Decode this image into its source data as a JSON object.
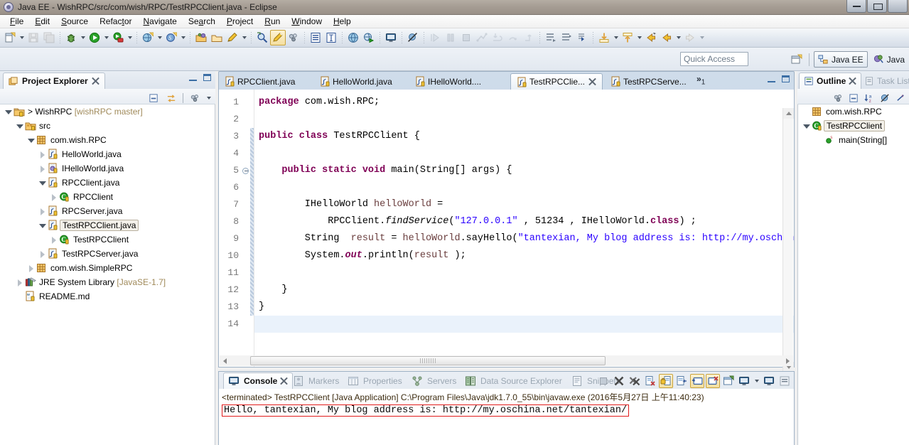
{
  "window": {
    "title": "Java EE - WishRPC/src/com/wish/RPC/TestRPCClient.java - Eclipse",
    "app_icon": "eclipse-icon",
    "controls": {
      "minimize": "minimize-icon",
      "maximize": "maximize-icon",
      "close": "close-icon"
    }
  },
  "menubar": {
    "items": [
      {
        "label": "File",
        "mnemonic": "F"
      },
      {
        "label": "Edit",
        "mnemonic": "E"
      },
      {
        "label": "Source",
        "mnemonic": "S"
      },
      {
        "label": "Refactor",
        "mnemonic": "t"
      },
      {
        "label": "Navigate",
        "mnemonic": "N"
      },
      {
        "label": "Search",
        "mnemonic": "a"
      },
      {
        "label": "Project",
        "mnemonic": "P"
      },
      {
        "label": "Run",
        "mnemonic": "R"
      },
      {
        "label": "Window",
        "mnemonic": "W"
      },
      {
        "label": "Help",
        "mnemonic": "H"
      }
    ]
  },
  "toolbar": {
    "groups": [
      {
        "items": [
          {
            "name": "new-wizard-icon",
            "has_dropdown": true,
            "enabled": true
          },
          {
            "name": "save-icon",
            "has_dropdown": false,
            "enabled": false
          },
          {
            "name": "save-all-icon",
            "has_dropdown": false,
            "enabled": false
          }
        ]
      },
      {
        "items": [
          {
            "name": "debug-icon",
            "has_dropdown": true,
            "enabled": true
          },
          {
            "name": "run-icon",
            "has_dropdown": true,
            "enabled": true
          },
          {
            "name": "external-tools-icon",
            "has_dropdown": true,
            "enabled": true
          }
        ]
      },
      {
        "items": [
          {
            "name": "new-server-icon",
            "has_dropdown": true,
            "enabled": true
          },
          {
            "name": "new-ejb-icon",
            "has_dropdown": true,
            "enabled": true
          }
        ]
      },
      {
        "items": [
          {
            "name": "open-type-icon",
            "has_dropdown": false,
            "enabled": true
          },
          {
            "name": "open-task-icon",
            "has_dropdown": false,
            "enabled": true
          },
          {
            "name": "new-annotation-icon",
            "has_dropdown": true,
            "enabled": true
          }
        ]
      },
      {
        "items": [
          {
            "name": "search-icon",
            "has_dropdown": false,
            "enabled": true
          },
          {
            "name": "toggle-mark-occurrences-icon",
            "has_dropdown": false,
            "enabled": true,
            "active": true
          },
          {
            "name": "link-with-editor-icon",
            "has_dropdown": false,
            "enabled": true
          }
        ]
      },
      {
        "items": [
          {
            "name": "show-whitespace-icon",
            "has_dropdown": false,
            "enabled": true
          },
          {
            "name": "toggle-block-selection-icon",
            "has_dropdown": false,
            "enabled": true
          }
        ]
      },
      {
        "items": [
          {
            "name": "open-browser-icon",
            "has_dropdown": false,
            "enabled": true
          },
          {
            "name": "run-on-server-icon",
            "has_dropdown": false,
            "enabled": true
          }
        ]
      },
      {
        "items": [
          {
            "name": "open-console-icon",
            "has_dropdown": false,
            "enabled": true
          }
        ]
      },
      {
        "items": [
          {
            "name": "skip-breakpoints-icon",
            "has_dropdown": false,
            "enabled": true
          }
        ]
      },
      {
        "items": [
          {
            "name": "resume-icon",
            "has_dropdown": false,
            "enabled": false
          },
          {
            "name": "suspend-icon",
            "has_dropdown": false,
            "enabled": false
          },
          {
            "name": "terminate-icon",
            "has_dropdown": false,
            "enabled": false
          },
          {
            "name": "disconnect-icon",
            "has_dropdown": false,
            "enabled": false
          },
          {
            "name": "step-into-icon",
            "has_dropdown": false,
            "enabled": false
          },
          {
            "name": "step-over-icon",
            "has_dropdown": false,
            "enabled": false
          },
          {
            "name": "step-return-icon",
            "has_dropdown": false,
            "enabled": false
          }
        ]
      },
      {
        "items": [
          {
            "name": "next-annotation-icon",
            "has_dropdown": false,
            "enabled": true
          },
          {
            "name": "previous-annotation-icon",
            "has_dropdown": false,
            "enabled": true
          },
          {
            "name": "last-edit-location-icon",
            "has_dropdown": false,
            "enabled": true
          }
        ]
      },
      {
        "items": [
          {
            "name": "next-edit-icon",
            "has_dropdown": true,
            "enabled": true
          },
          {
            "name": "previous-edit-icon",
            "has_dropdown": true,
            "enabled": true
          },
          {
            "name": "back-icon",
            "has_dropdown": false,
            "enabled": true
          },
          {
            "name": "forward-history-icon",
            "has_dropdown": true,
            "enabled": true
          },
          {
            "name": "forward-icon",
            "has_dropdown": true,
            "enabled": false
          }
        ]
      }
    ]
  },
  "quick_access": {
    "placeholder": "Quick Access",
    "value": ""
  },
  "perspectives": {
    "open_perspective_icon": "open-perspective-icon",
    "items": [
      {
        "label": "Java EE",
        "icon": "java-ee-perspective-icon",
        "selected": true
      },
      {
        "label": "Java",
        "icon": "java-perspective-icon",
        "selected": false
      }
    ]
  },
  "project_explorer": {
    "title": "Project Explorer",
    "close_icon": "close-icon",
    "minimize_icon": "minimize-icon",
    "maximize_icon": "maximize-icon",
    "toolbar_icons": [
      "collapse-all-icon",
      "link-with-editor-icon",
      "view-menu-icon",
      "view-dropdown-icon"
    ],
    "tree": [
      {
        "indent": 0,
        "twisty": "open",
        "icon": "project-icon",
        "label": "> WishRPC",
        "suffix": "[wishRPC master]",
        "selected": false
      },
      {
        "indent": 1,
        "twisty": "open",
        "icon": "source-folder-icon",
        "label": "src",
        "suffix": "",
        "selected": false
      },
      {
        "indent": 2,
        "twisty": "open",
        "icon": "package-icon",
        "label": "com.wish.RPC",
        "suffix": "",
        "selected": false
      },
      {
        "indent": 3,
        "twisty": "closed",
        "icon": "java-file-icon",
        "label": "HelloWorld.java",
        "suffix": "",
        "selected": false
      },
      {
        "indent": 3,
        "twisty": "closed",
        "icon": "java-interface-file-icon",
        "label": "IHelloWorld.java",
        "suffix": "",
        "selected": false
      },
      {
        "indent": 3,
        "twisty": "open",
        "icon": "java-file-icon",
        "label": "RPCClient.java",
        "suffix": "",
        "selected": false
      },
      {
        "indent": 4,
        "twisty": "closed",
        "icon": "class-icon",
        "label": "RPCClient",
        "suffix": "",
        "selected": false
      },
      {
        "indent": 3,
        "twisty": "closed",
        "icon": "java-file-icon",
        "label": "RPCServer.java",
        "suffix": "",
        "selected": false
      },
      {
        "indent": 3,
        "twisty": "open",
        "icon": "java-file-icon",
        "label": "TestRPCClient.java",
        "suffix": "",
        "selected": true
      },
      {
        "indent": 4,
        "twisty": "closed",
        "icon": "class-icon",
        "label": "TestRPCClient",
        "suffix": "",
        "selected": false
      },
      {
        "indent": 3,
        "twisty": "closed",
        "icon": "java-file-icon",
        "label": "TestRPCServer.java",
        "suffix": "",
        "selected": false
      },
      {
        "indent": 2,
        "twisty": "closed",
        "icon": "package-icon",
        "label": "com.wish.SimpleRPC",
        "suffix": "",
        "selected": false
      },
      {
        "indent": 1,
        "twisty": "closed",
        "icon": "jre-library-icon",
        "label": "JRE System Library",
        "suffix": "[JavaSE-1.7]",
        "selected": false
      },
      {
        "indent": 1,
        "twisty": "none",
        "icon": "markdown-file-icon",
        "label": "README.md",
        "suffix": "",
        "selected": false
      }
    ]
  },
  "editor": {
    "tabs": [
      {
        "label": "RPCClient.java",
        "icon": "java-file-icon",
        "selected": false,
        "closable": false
      },
      {
        "label": "HelloWorld.java",
        "icon": "java-file-icon",
        "selected": false,
        "closable": false
      },
      {
        "label": "IHelloWorld....",
        "icon": "java-file-icon",
        "selected": false,
        "closable": false
      },
      {
        "label": "TestRPCClie...",
        "icon": "java-file-icon",
        "selected": true,
        "closable": true
      },
      {
        "label": "TestRPCServe...",
        "icon": "java-file-icon",
        "selected": false,
        "closable": false
      }
    ],
    "overflow_indicator": "»",
    "overflow_count": "1",
    "minimize_icon": "minimize-icon",
    "maximize_icon": "maximize-icon",
    "current_line": 14,
    "lines": [
      {
        "n": 1,
        "fold": false,
        "tokens": [
          {
            "t": "kw",
            "v": "package"
          },
          {
            "t": "plain",
            "v": " com.wish.RPC;"
          }
        ]
      },
      {
        "n": 2,
        "fold": false,
        "tokens": []
      },
      {
        "n": 3,
        "fold": false,
        "tokens": [
          {
            "t": "kw",
            "v": "public class"
          },
          {
            "t": "plain",
            "v": " TestRPCClient {"
          }
        ]
      },
      {
        "n": 4,
        "fold": false,
        "tokens": []
      },
      {
        "n": 5,
        "fold": true,
        "tokens": [
          {
            "t": "plain",
            "v": "    "
          },
          {
            "t": "kw",
            "v": "public static void"
          },
          {
            "t": "plain",
            "v": " main(String[] args) {"
          }
        ]
      },
      {
        "n": 6,
        "fold": false,
        "tokens": []
      },
      {
        "n": 7,
        "fold": false,
        "tokens": [
          {
            "t": "plain",
            "v": "        IHelloWorld "
          },
          {
            "t": "lf",
            "v": "helloWorld"
          },
          {
            "t": "plain",
            "v": " ="
          }
        ]
      },
      {
        "n": 8,
        "fold": false,
        "tokens": [
          {
            "t": "plain",
            "v": "            RPCClient."
          },
          {
            "t": "mthi",
            "v": "findService"
          },
          {
            "t": "plain",
            "v": "("
          },
          {
            "t": "st",
            "v": "\"127.0.0.1\""
          },
          {
            "t": "plain",
            "v": " , 51234 , IHelloWorld."
          },
          {
            "t": "kw",
            "v": "class"
          },
          {
            "t": "plain",
            "v": ") ;"
          }
        ]
      },
      {
        "n": 9,
        "fold": false,
        "tokens": [
          {
            "t": "plain",
            "v": "        String  "
          },
          {
            "t": "lf",
            "v": "result"
          },
          {
            "t": "plain",
            "v": " = "
          },
          {
            "t": "lf",
            "v": "helloWorld"
          },
          {
            "t": "plain",
            "v": ".sayHello("
          },
          {
            "t": "st",
            "v": "\"tantexian, My blog address is: http://my.oschina.net/tantexian/\""
          },
          {
            "t": "plain",
            "v": ");"
          }
        ]
      },
      {
        "n": 10,
        "fold": false,
        "tokens": [
          {
            "t": "plain",
            "v": "        System."
          },
          {
            "t": "kwi",
            "v": "out"
          },
          {
            "t": "plain",
            "v": ".println("
          },
          {
            "t": "lf",
            "v": "result"
          },
          {
            "t": "plain",
            "v": " );"
          }
        ]
      },
      {
        "n": 11,
        "fold": false,
        "tokens": []
      },
      {
        "n": 12,
        "fold": false,
        "tokens": [
          {
            "t": "plain",
            "v": "    }"
          }
        ]
      },
      {
        "n": 13,
        "fold": false,
        "tokens": [
          {
            "t": "plain",
            "v": "}"
          }
        ]
      },
      {
        "n": 14,
        "fold": false,
        "tokens": []
      }
    ]
  },
  "console": {
    "tabs": [
      {
        "label": "Console",
        "icon": "console-icon",
        "selected": true,
        "closable": true
      },
      {
        "label": "Markers",
        "icon": "markers-icon",
        "selected": false,
        "closable": false
      },
      {
        "label": "Properties",
        "icon": "properties-icon",
        "selected": false,
        "closable": false
      },
      {
        "label": "Servers",
        "icon": "servers-icon",
        "selected": false,
        "closable": false
      },
      {
        "label": "Data Source Explorer",
        "icon": "data-source-explorer-icon",
        "selected": false,
        "closable": false
      },
      {
        "label": "Snippets",
        "icon": "snippets-icon",
        "selected": false,
        "closable": false
      }
    ],
    "toolbar_icons": [
      "terminate-icon",
      "remove-launch-icon",
      "remove-all-terminated-icon",
      "clear-console-icon",
      "scroll-lock-icon",
      "word-wrap-icon",
      "show-console-on-output-icon",
      "show-console-on-error-icon",
      "pin-console-icon",
      "display-selected-console-icon",
      "console-dropdown-icon",
      "open-console-icon",
      "view-menu-icon"
    ],
    "launch_header": "<terminated> TestRPCClient [Java Application] C:\\Program Files\\Java\\jdk1.7.0_55\\bin\\javaw.exe (2016年5月27日 上午11:40:23)",
    "output": "Hello, tantexian, My blog address is: http://my.oschina.net/tantexian/",
    "output_highlight_color": "#e11b1b"
  },
  "outline": {
    "tabs": [
      {
        "label": "Outline",
        "icon": "outline-icon",
        "selected": true,
        "closable": true
      },
      {
        "label": "Task List",
        "icon": "task-list-icon",
        "selected": false,
        "closable": false
      }
    ],
    "toolbar_icons": [
      "focus-on-active-task-icon",
      "collapse-all-icon",
      "sort-icon",
      "hide-fields-icon",
      "hide-static-icon"
    ],
    "tree": [
      {
        "indent": 0,
        "twisty": "none",
        "icon": "package-icon",
        "label": "com.wish.RPC",
        "selected": false
      },
      {
        "indent": 0,
        "twisty": "open",
        "icon": "class-icon",
        "label": "TestRPCClient",
        "selected": true
      },
      {
        "indent": 1,
        "twisty": "none",
        "icon": "method-public-static-icon",
        "label": "main(String[]",
        "selected": false
      }
    ]
  },
  "colors": {
    "titlebar": "#a69d94",
    "toolbar_bg": "#e4eaf1",
    "panel_bg": "#dde4ed",
    "editor_bg": "#ffffff",
    "keyword": "#7f0055",
    "string": "#2a00ff",
    "local_var": "#6a3e3e",
    "current_line": "#eaf2fb",
    "selection_border": "#b9b1a0",
    "error_red": "#e11b1b"
  }
}
